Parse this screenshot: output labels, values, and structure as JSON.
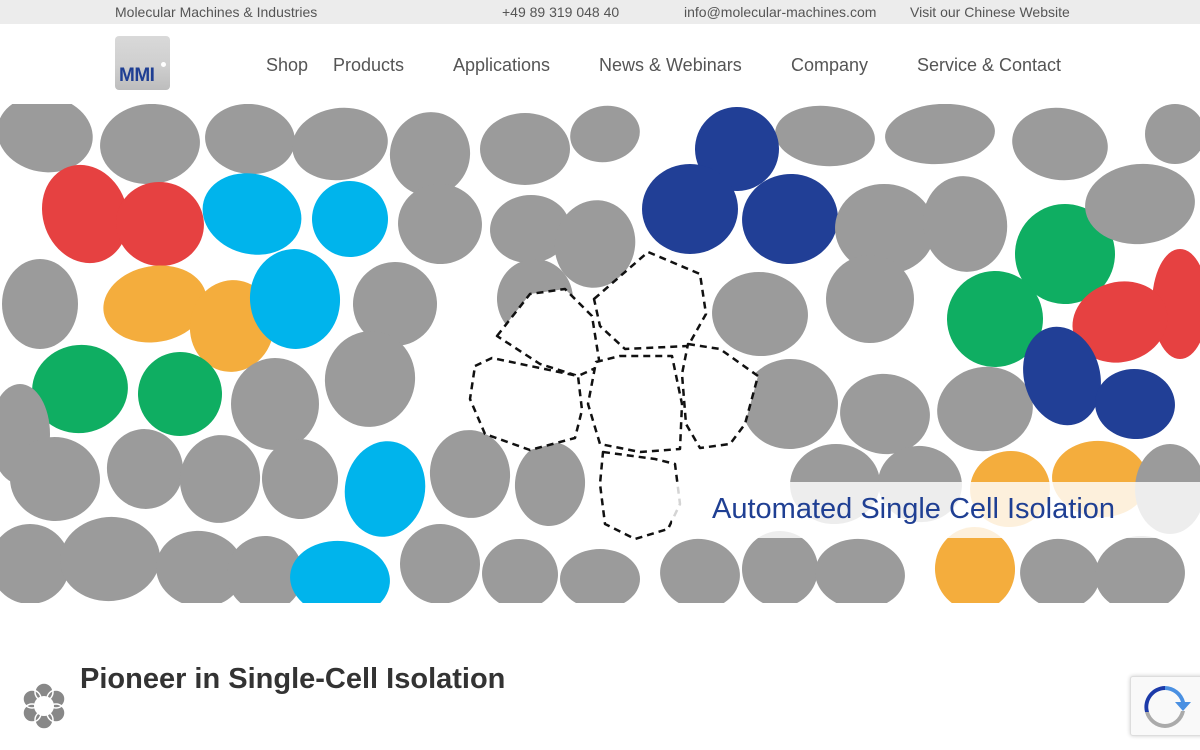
{
  "topbar": {
    "company": "Molecular Machines & Industries",
    "phone": "+49 89 319 048 40",
    "email": "info@molecular-machines.com",
    "chinese_link": "Visit our Chinese Website"
  },
  "logo": {
    "text": "MMI"
  },
  "nav": {
    "shop": "Shop",
    "products": "Products",
    "applications": "Applications",
    "news": "News & Webinars",
    "company": "Company",
    "service": "Service & Contact"
  },
  "hero": {
    "caption": "Automated Single Cell Isolation",
    "colors": {
      "grey": "#9b9b9b",
      "red": "#e64141",
      "orange": "#f4ad3d",
      "cyan": "#00b4ec",
      "green": "#0fae62",
      "navy": "#213f96"
    }
  },
  "main": {
    "title": "Pioneer in Single-Cell Isolation"
  },
  "widgets": {
    "privacy_icon": "cookie-settings-icon",
    "recaptcha_icon": "recaptcha-icon"
  }
}
